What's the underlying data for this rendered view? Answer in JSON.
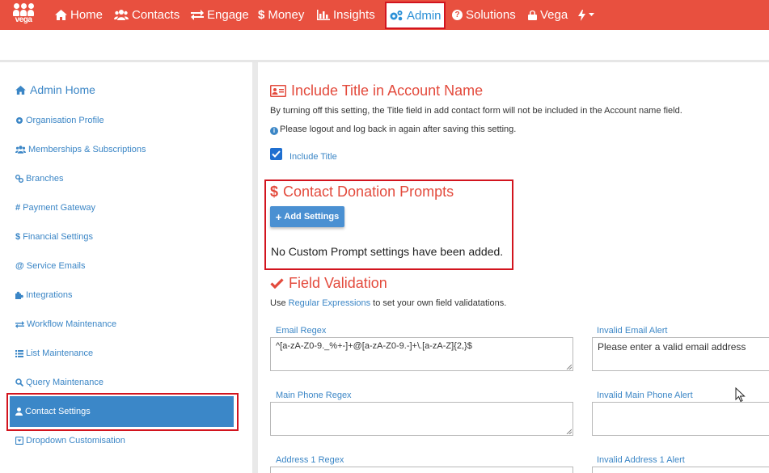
{
  "brand": {
    "logo_text": "vega"
  },
  "nav": {
    "home": "Home",
    "contacts": "Contacts",
    "engage": "Engage",
    "money": "Money",
    "insights": "Insights",
    "admin": "Admin",
    "solutions": "Solutions",
    "vega": "Vega"
  },
  "sidebar": {
    "admin_home": "Admin Home",
    "items": [
      "Organisation Profile",
      "Memberships & Subscriptions",
      "Branches",
      "Payment Gateway",
      "Financial Settings",
      "Service Emails",
      "Integrations",
      "Workflow Maintenance",
      "List Maintenance",
      "Query Maintenance",
      "Contact Settings",
      "Dropdown Customisation"
    ]
  },
  "title_section": {
    "heading": "Include Title in Account Name",
    "description": "By turning off this setting, the Title field in add contact form will not be included in the Account name field.",
    "note": "Please logout and log back in again after saving this setting.",
    "checkbox_label": "Include Title"
  },
  "donation_section": {
    "heading": "Contact Donation Prompts",
    "add_button": "Add Settings",
    "empty_text": "No Custom Prompt settings have been added."
  },
  "validation_section": {
    "heading": "Field Validation",
    "intro_before": "Use ",
    "intro_link": "Regular Expressions",
    "intro_after": " to set your own field validatations.",
    "email_regex_label": "Email Regex",
    "email_regex_value": "^[a-zA-Z0-9._%+-]+@[a-zA-Z0-9.-]+\\.[a-zA-Z]{2,}$",
    "email_alert_label": "Invalid Email Alert",
    "email_alert_value": "Please enter a valid email address",
    "phone_regex_label": "Main Phone Regex",
    "phone_alert_label": "Invalid Main Phone Alert",
    "address_regex_label": "Address 1 Regex",
    "address_alert_label": "Invalid Address 1 Alert"
  },
  "colors": {
    "nav_bg": "#e8503f",
    "accent_blue": "#3b86c6",
    "heading_red": "#e34a3c",
    "highlight_red": "#d2141e"
  }
}
